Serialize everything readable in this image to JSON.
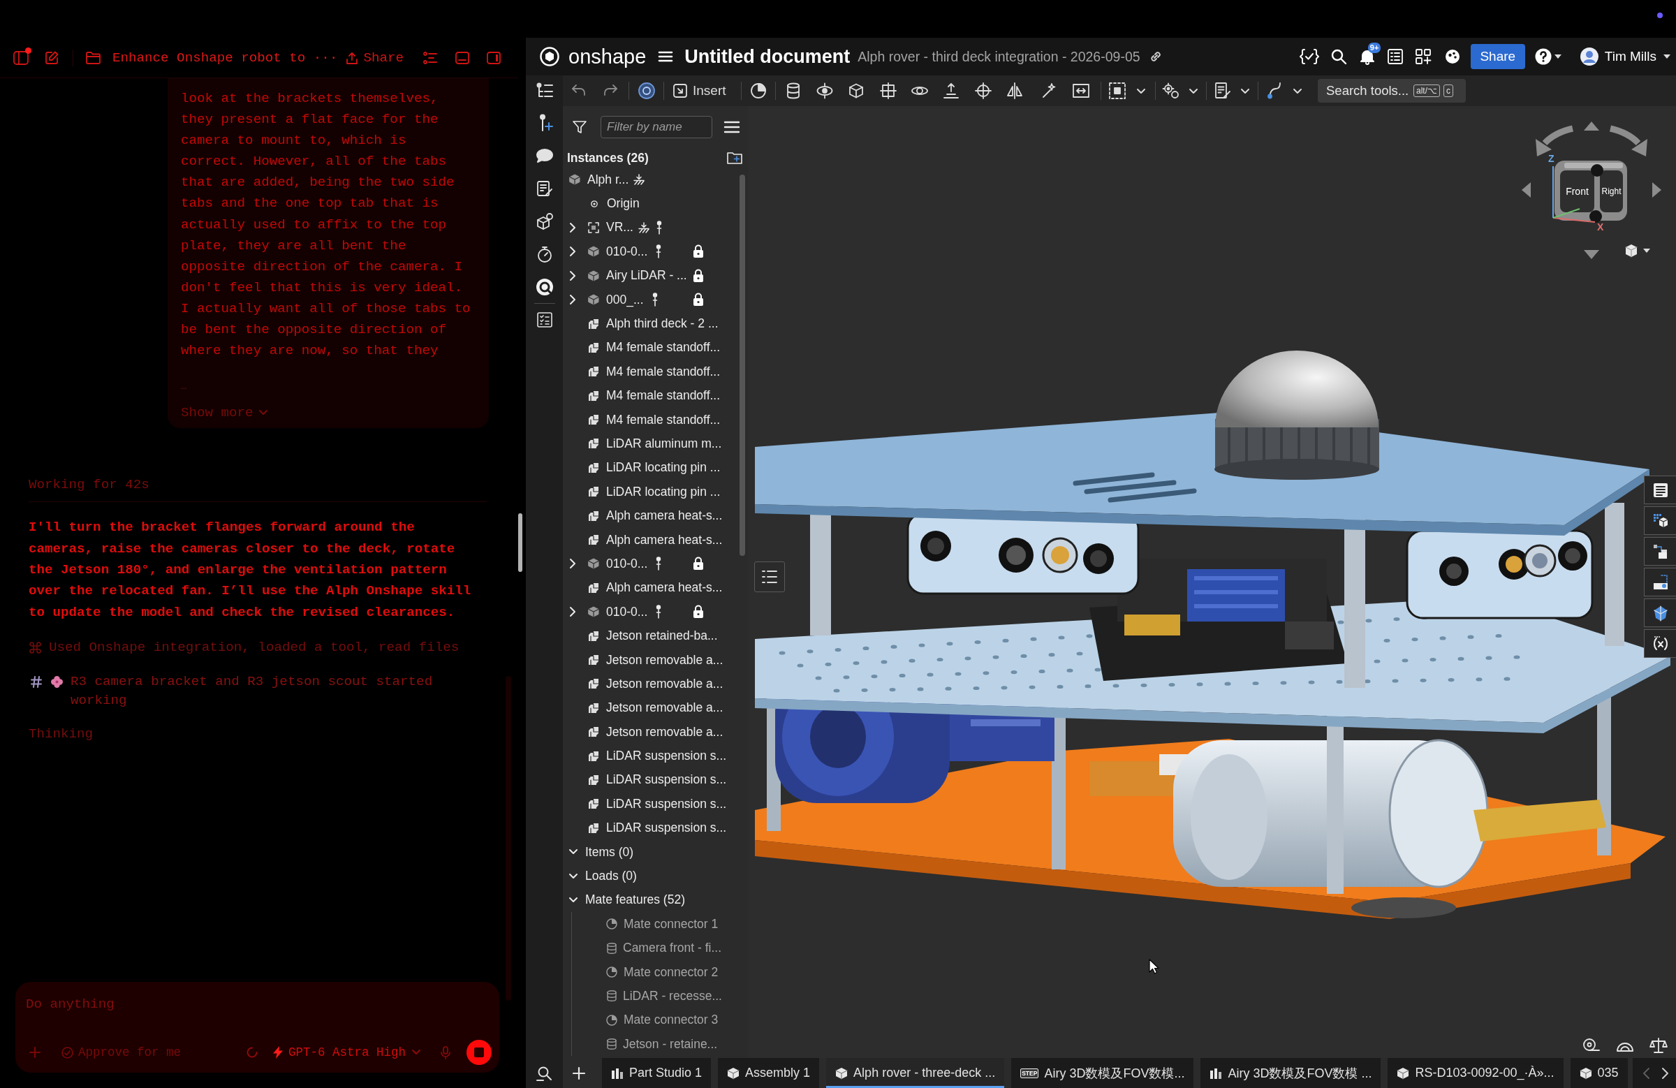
{
  "chat": {
    "header": {
      "unread": true,
      "title": "Enhance Onshape robot to ···",
      "share": "Share"
    },
    "user_message": {
      "text": "look at the brackets themselves, they present a flat face for the camera to mount to, which is correct. However, all of the tabs that are added, being the two side tabs and the one top tab that is actually used to affix to the top plate, they are all bent the opposite direction of the camera. I don't feel that this is very ideal. I actually want all of those tabs to be bent the opposite direction of where they are now, so that they",
      "ellipsis": "…",
      "show_more": "Show more"
    },
    "status": "Working for 42s",
    "reply": "I'll turn the bracket flanges forward around the cameras, raise the cameras closer to the deck, rotate the Jetson 180°, and enlarge the ventilation pattern over the relocated fan. I’ll use the Alph Onshape skill to update the model and check the revised clearances.",
    "activity": [
      {
        "kind": "tools",
        "text": "Used Onshape integration, loaded a tool, read files"
      },
      {
        "kind": "agents",
        "text": "R3 camera bracket and R3 jetson scout started working"
      }
    ],
    "thinking": "Thinking",
    "composer": {
      "placeholder": "Do anything",
      "approve": "Approve for me",
      "model": "GPT-6 Astra High"
    }
  },
  "onshape": {
    "header": {
      "brand": "onshape",
      "document": "Untitled document",
      "workspace": "Alph rover - third deck integration - 2026-09-05",
      "notifications": "9+",
      "share": "Share",
      "user": "Tim Mills"
    },
    "toolbar": {
      "insert": "Insert",
      "search_placeholder": "Search tools...",
      "shortcut_keys": [
        "alt/⌥",
        "c"
      ]
    },
    "tree": {
      "filter_placeholder": "Filter by name",
      "instances_title": "Instances (26)",
      "instances": [
        {
          "label": "Alph r...",
          "kind": "root",
          "fixed": true,
          "mated": false,
          "locked": false
        },
        {
          "label": "Origin",
          "kind": "origin",
          "fixed": false,
          "mated": false,
          "locked": false
        },
        {
          "label": "VR...",
          "kind": "frame",
          "expanded": false,
          "fixed": true,
          "mated": true,
          "locked": false
        },
        {
          "label": "010-0...",
          "kind": "assembly",
          "expanded": false,
          "fixed": false,
          "mated": true,
          "locked": true
        },
        {
          "label": "Airy LiDAR - ...",
          "kind": "assembly",
          "expanded": false,
          "fixed": false,
          "mated": false,
          "locked": true
        },
        {
          "label": "000_...",
          "kind": "assembly",
          "expanded": false,
          "fixed": false,
          "mated": true,
          "locked": true
        },
        {
          "label": "Alph third deck - 2 ...",
          "kind": "part",
          "fixed": false,
          "mated": false,
          "locked": false
        },
        {
          "label": "M4 female standoff...",
          "kind": "part",
          "fixed": false,
          "mated": false,
          "locked": false
        },
        {
          "label": "M4 female standoff...",
          "kind": "part",
          "fixed": false,
          "mated": false,
          "locked": false
        },
        {
          "label": "M4 female standoff...",
          "kind": "part",
          "fixed": false,
          "mated": false,
          "locked": false
        },
        {
          "label": "M4 female standoff...",
          "kind": "part",
          "fixed": false,
          "mated": false,
          "locked": false
        },
        {
          "label": "LiDAR aluminum m...",
          "kind": "part",
          "fixed": false,
          "mated": false,
          "locked": false
        },
        {
          "label": "LiDAR locating pin ...",
          "kind": "part",
          "fixed": false,
          "mated": false,
          "locked": false
        },
        {
          "label": "LiDAR locating pin ...",
          "kind": "part",
          "fixed": false,
          "mated": false,
          "locked": false
        },
        {
          "label": "Alph camera heat-s...",
          "kind": "part",
          "fixed": false,
          "mated": false,
          "locked": false
        },
        {
          "label": "Alph camera heat-s...",
          "kind": "part",
          "fixed": false,
          "mated": false,
          "locked": false
        },
        {
          "label": "010-0...",
          "kind": "assembly",
          "expanded": false,
          "fixed": false,
          "mated": true,
          "locked": true
        },
        {
          "label": "Alph camera heat-s...",
          "kind": "part",
          "fixed": false,
          "mated": false,
          "locked": false
        },
        {
          "label": "010-0...",
          "kind": "assembly",
          "expanded": false,
          "fixed": false,
          "mated": true,
          "locked": true
        },
        {
          "label": "Jetson retained-ba...",
          "kind": "part",
          "fixed": false,
          "mated": false,
          "locked": false
        },
        {
          "label": "Jetson removable a...",
          "kind": "part",
          "fixed": false,
          "mated": false,
          "locked": false
        },
        {
          "label": "Jetson removable a...",
          "kind": "part",
          "fixed": false,
          "mated": false,
          "locked": false
        },
        {
          "label": "Jetson removable a...",
          "kind": "part",
          "fixed": false,
          "mated": false,
          "locked": false
        },
        {
          "label": "Jetson removable a...",
          "kind": "part",
          "fixed": false,
          "mated": false,
          "locked": false
        },
        {
          "label": "LiDAR suspension s...",
          "kind": "part",
          "fixed": false,
          "mated": false,
          "locked": false
        },
        {
          "label": "LiDAR suspension s...",
          "kind": "part",
          "fixed": false,
          "mated": false,
          "locked": false
        },
        {
          "label": "LiDAR suspension s...",
          "kind": "part",
          "fixed": false,
          "mated": false,
          "locked": false
        },
        {
          "label": "LiDAR suspension s...",
          "kind": "part",
          "fixed": false,
          "mated": false,
          "locked": false
        }
      ],
      "groups": [
        {
          "label": "Items (0)",
          "expanded": true
        },
        {
          "label": "Loads (0)",
          "expanded": true
        },
        {
          "label": "Mate features (52)",
          "expanded": true,
          "children": [
            {
              "label": "Mate connector 1",
              "kind": "connector"
            },
            {
              "label": "Camera front - fi...",
              "kind": "fastened"
            },
            {
              "label": "Mate connector 2",
              "kind": "connector"
            },
            {
              "label": "LiDAR - recesse...",
              "kind": "fastened"
            },
            {
              "label": "Mate connector 3",
              "kind": "connector"
            },
            {
              "label": "Jetson - retaine...",
              "kind": "fastened"
            }
          ]
        }
      ]
    },
    "viewcube": {
      "front": "Front",
      "right": "Right",
      "z_axis": "Z",
      "x_axis": "X"
    },
    "tabs": [
      {
        "label": "Part Studio 1",
        "kind": "partstudio",
        "selected": false
      },
      {
        "label": "Assembly 1",
        "kind": "assembly",
        "selected": false
      },
      {
        "label": "Alph rover - three-deck ...",
        "kind": "assembly",
        "selected": true
      },
      {
        "label": "Airy 3D数模及FOV数模...",
        "kind": "file",
        "badge": "STEP",
        "selected": false
      },
      {
        "label": "Airy 3D数模及FOV数模 ...",
        "kind": "partstudio",
        "selected": false
      },
      {
        "label": "RS-D103-0092-00_·À»...",
        "kind": "assembly",
        "selected": false
      },
      {
        "label": "035",
        "kind": "assembly",
        "selected": false
      }
    ]
  }
}
